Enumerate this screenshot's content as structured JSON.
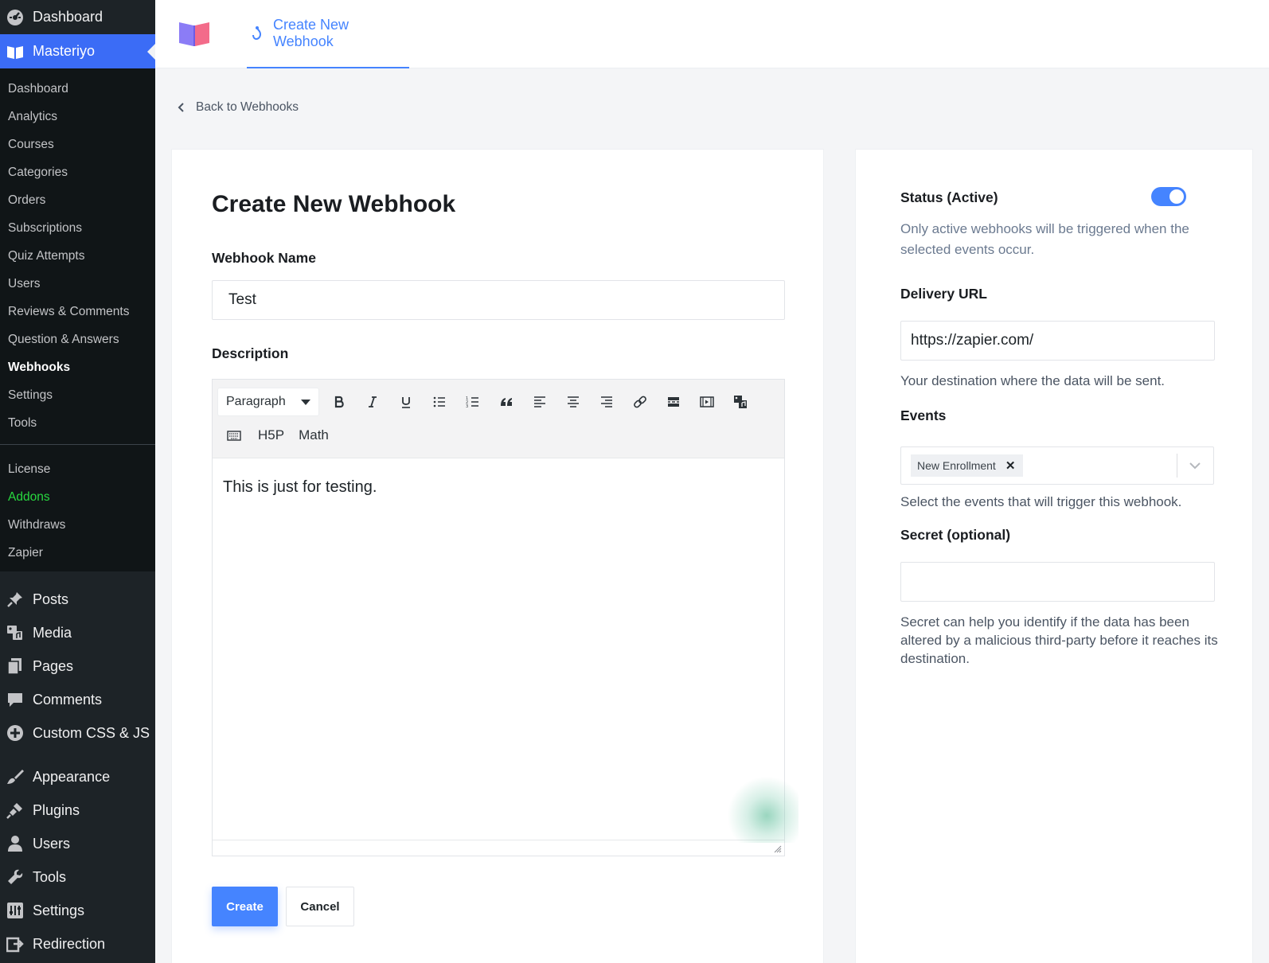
{
  "sidebar": {
    "top_items": [
      {
        "label": "Dashboard",
        "icon": "dashboard-icon"
      },
      {
        "label": "Masteriyo",
        "icon": "masteriyo-icon",
        "active": true
      }
    ],
    "sub_items": [
      "Dashboard",
      "Analytics",
      "Courses",
      "Categories",
      "Orders",
      "Subscriptions",
      "Quiz Attempts",
      "Users",
      "Reviews & Comments",
      "Question & Answers",
      "Webhooks",
      "Settings",
      "Tools"
    ],
    "sub_items2": [
      "License",
      "Addons",
      "Withdraws",
      "Zapier"
    ],
    "main_items": [
      {
        "label": "Posts",
        "icon": "pin-icon"
      },
      {
        "label": "Media",
        "icon": "media-icon"
      },
      {
        "label": "Pages",
        "icon": "pages-icon"
      },
      {
        "label": "Comments",
        "icon": "comment-icon"
      },
      {
        "label": "Custom CSS & JS",
        "icon": "plus-circle-icon"
      },
      {
        "label": "Appearance",
        "icon": "brush-icon"
      },
      {
        "label": "Plugins",
        "icon": "plugin-icon"
      },
      {
        "label": "Users",
        "icon": "user-icon"
      },
      {
        "label": "Tools",
        "icon": "wrench-icon"
      },
      {
        "label": "Settings",
        "icon": "settings-icon"
      },
      {
        "label": "Redirection",
        "icon": "redirect-icon"
      }
    ],
    "addons_color": "#28d93f",
    "active_color": "#3b6cf6"
  },
  "topbar": {
    "tab_label": "Create New Webhook",
    "accent": "#4584ff"
  },
  "back_link": "Back to Webhooks",
  "form": {
    "title": "Create New Webhook",
    "name_label": "Webhook Name",
    "name_value": "Test",
    "description_label": "Description",
    "editor": {
      "block_format": "Paragraph",
      "extra_buttons": [
        "H5P",
        "Math"
      ],
      "content": "This is just for testing."
    },
    "create_label": "Create",
    "cancel_label": "Cancel"
  },
  "settings": {
    "status_label": "Status (Active)",
    "status_on": true,
    "status_help": "Only active webhooks will be triggered when the selected events occur.",
    "url_label": "Delivery URL",
    "url_value": "https://zapier.com/",
    "url_help": "Your destination where the data will be sent.",
    "events_label": "Events",
    "events_selected": [
      "New Enrollment"
    ],
    "events_help": "Select the events that will trigger this webhook.",
    "secret_label": "Secret (optional)",
    "secret_value": "",
    "secret_help": "Secret can help you identify if the data has been altered by a malicious third-party before it reaches its destination."
  }
}
